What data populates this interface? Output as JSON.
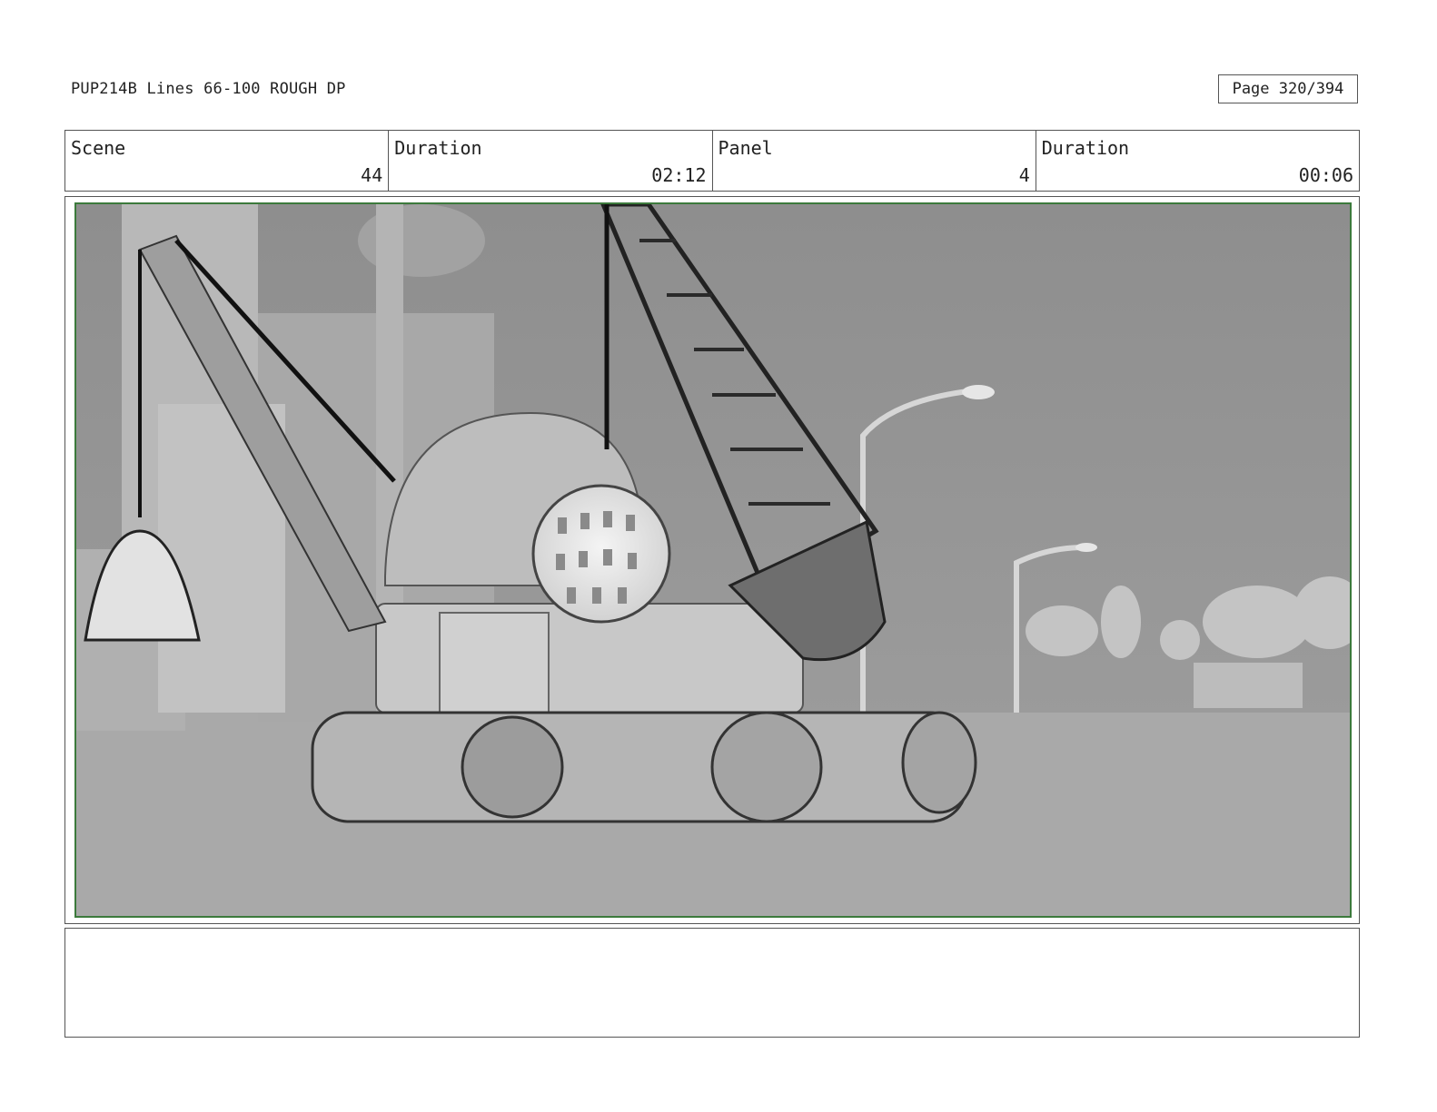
{
  "header": {
    "title": "PUP214B Lines 66-100 ROUGH DP",
    "page": "Page 320/394"
  },
  "info": {
    "scene_label": "Scene",
    "scene_value": "44",
    "scene_duration_label": "Duration",
    "scene_duration_value": "02:12",
    "panel_label": "Panel",
    "panel_value": "4",
    "panel_duration_label": "Duration",
    "panel_duration_value": "00:06"
  },
  "panel": {
    "image_subject": "crane-truck-with-wrecking-ball-and-claw",
    "frame_color": "#3c7a3c"
  },
  "notes": {
    "text": ""
  }
}
